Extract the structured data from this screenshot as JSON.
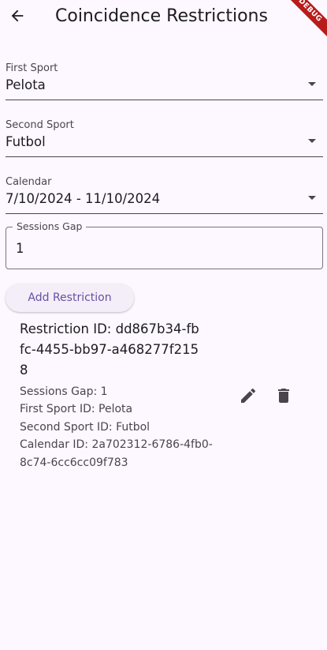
{
  "app_bar": {
    "title": "Coincidence Restrictions",
    "back_icon": "arrow-back-icon",
    "debug_label": "DEBUG"
  },
  "form": {
    "first_sport": {
      "label": "First Sport",
      "value": "Pelota"
    },
    "second_sport": {
      "label": "Second Sport",
      "value": "Futbol"
    },
    "calendar": {
      "label": "Calendar",
      "value": "7/10/2024 - 11/10/2024"
    },
    "sessions_gap": {
      "label": "Sessions Gap",
      "value": "1"
    },
    "add_button_label": "Add Restriction"
  },
  "restriction": {
    "title": "Restriction ID: dd867b34-fbfc-4455-bb97-a468277f2158",
    "sessions_gap": "Sessions Gap: 1",
    "first_sport": "First Sport ID: Pelota",
    "second_sport": "Second Sport ID: Futbol",
    "calendar": "Calendar ID: 2a702312-6786-4fb0-8c74-6cc6cc09f783",
    "edit_icon": "edit-icon",
    "delete_icon": "delete-icon"
  },
  "colors": {
    "background": "#fdf7ff",
    "accent": "#6750a4",
    "text": "#1d1b20",
    "debug_banner": "#b71c1c"
  }
}
